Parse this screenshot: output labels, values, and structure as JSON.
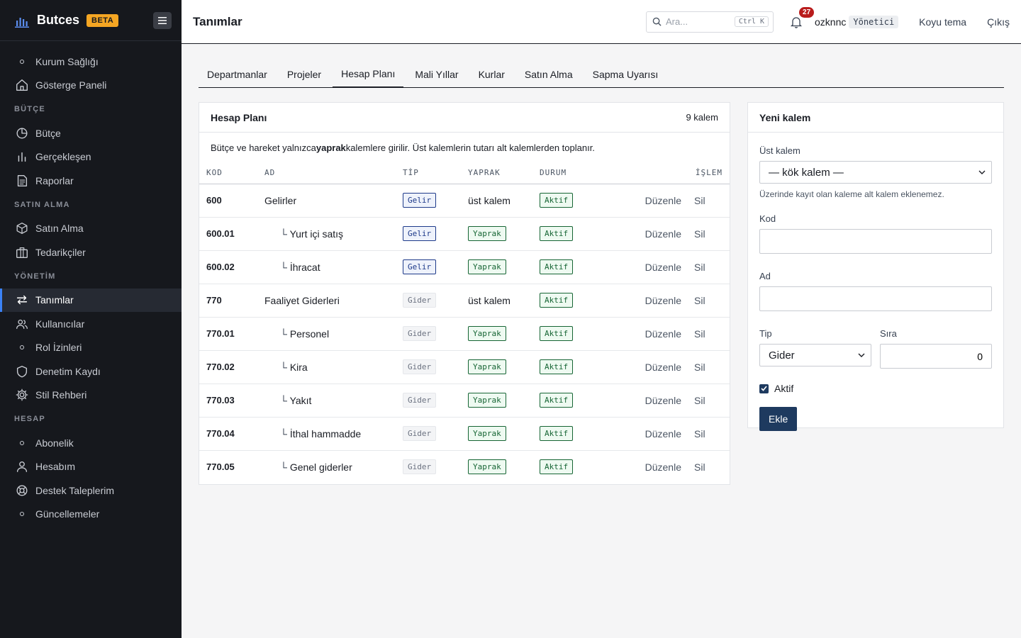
{
  "brand": {
    "name": "Butces",
    "badge": "BETA"
  },
  "sidebar": {
    "items_top": [
      {
        "label": "Kurum Sağlığı",
        "icon": "dot-icon"
      },
      {
        "label": "Gösterge Paneli",
        "icon": "home-icon"
      }
    ],
    "sections": [
      {
        "title": "BÜTÇE",
        "items": [
          {
            "label": "Bütçe",
            "icon": "pie-chart-icon"
          },
          {
            "label": "Gerçekleşen",
            "icon": "bar-chart-icon"
          },
          {
            "label": "Raporlar",
            "icon": "document-icon"
          }
        ]
      },
      {
        "title": "SATIN ALMA",
        "items": [
          {
            "label": "Satın Alma",
            "icon": "box-icon"
          },
          {
            "label": "Tedarikçiler",
            "icon": "briefcase-icon"
          }
        ]
      },
      {
        "title": "YÖNETİM",
        "items": [
          {
            "label": "Tanımlar",
            "icon": "arrows-icon",
            "active": true
          },
          {
            "label": "Kullanıcılar",
            "icon": "users-icon"
          },
          {
            "label": "Rol İzinleri",
            "icon": "dot-icon"
          },
          {
            "label": "Denetim Kaydı",
            "icon": "shield-icon"
          },
          {
            "label": "Stil Rehberi",
            "icon": "gear-icon"
          }
        ]
      },
      {
        "title": "HESAP",
        "items": [
          {
            "label": "Abonelik",
            "icon": "dot-icon"
          },
          {
            "label": "Hesabım",
            "icon": "user-icon"
          },
          {
            "label": "Destek Taleplerim",
            "icon": "lifebuoy-icon"
          },
          {
            "label": "Güncellemeler",
            "icon": "dot-icon"
          }
        ]
      }
    ]
  },
  "header": {
    "title": "Tanımlar",
    "search_placeholder": "Ara...",
    "search_shortcut": "Ctrl K",
    "notifications": "27",
    "username": "ozknnc",
    "role": "Yönetici",
    "theme_link": "Koyu tema",
    "logout_link": "Çıkış"
  },
  "tabs": [
    {
      "label": "Departmanlar"
    },
    {
      "label": "Projeler"
    },
    {
      "label": "Hesap Planı",
      "active": true
    },
    {
      "label": "Mali Yıllar"
    },
    {
      "label": "Kurlar"
    },
    {
      "label": "Satın Alma"
    },
    {
      "label": "Sapma Uyarısı"
    }
  ],
  "accounts": {
    "title": "Hesap Planı",
    "count": "9 kalem",
    "note_before": "Bütçe ve hareket yalnızca ",
    "note_bold": "yaprak",
    "note_after": " kalemlere girilir. Üst kalemlerin tutarı alt kalemlerden toplanır.",
    "columns": {
      "code": "KOD",
      "name": "AD",
      "type": "TİP",
      "leaf": "YAPRAK",
      "status": "DURUM",
      "action": "İŞLEM"
    },
    "edit_label": "Düzenle",
    "delete_label": "Sil",
    "rows": [
      {
        "code": "600",
        "name": "Gelirler",
        "child": false,
        "type": "Gelir",
        "leaf": "üst kalem",
        "status": "Aktif"
      },
      {
        "code": "600.01",
        "name": "Yurt içi satış",
        "child": true,
        "type": "Gelir",
        "leaf": "Yaprak",
        "status": "Aktif"
      },
      {
        "code": "600.02",
        "name": "İhracat",
        "child": true,
        "type": "Gelir",
        "leaf": "Yaprak",
        "status": "Aktif"
      },
      {
        "code": "770",
        "name": "Faaliyet Giderleri",
        "child": false,
        "type": "Gider",
        "leaf": "üst kalem",
        "status": "Aktif"
      },
      {
        "code": "770.01",
        "name": "Personel",
        "child": true,
        "type": "Gider",
        "leaf": "Yaprak",
        "status": "Aktif"
      },
      {
        "code": "770.02",
        "name": "Kira",
        "child": true,
        "type": "Gider",
        "leaf": "Yaprak",
        "status": "Aktif"
      },
      {
        "code": "770.03",
        "name": "Yakıt",
        "child": true,
        "type": "Gider",
        "leaf": "Yaprak",
        "status": "Aktif"
      },
      {
        "code": "770.04",
        "name": "İthal hammadde",
        "child": true,
        "type": "Gider",
        "leaf": "Yaprak",
        "status": "Aktif"
      },
      {
        "code": "770.05",
        "name": "Genel giderler",
        "child": true,
        "type": "Gider",
        "leaf": "Yaprak",
        "status": "Aktif"
      }
    ]
  },
  "form": {
    "title": "Yeni kalem",
    "parent_label": "Üst kalem",
    "parent_value": "— kök kalem —",
    "parent_hint": "Üzerinde kayıt olan kaleme alt kalem eklenemez.",
    "code_label": "Kod",
    "code_value": "",
    "name_label": "Ad",
    "name_value": "",
    "type_label": "Tip",
    "type_value": "Gider",
    "order_label": "Sıra",
    "order_value": "0",
    "active_label": "Aktif",
    "active_checked": true,
    "submit_label": "Ekle"
  },
  "colors": {
    "sidebar_bg": "#16181d",
    "accent": "#1e3a5f",
    "gelir": "#1e3a8a",
    "yaprak": "#166534"
  }
}
